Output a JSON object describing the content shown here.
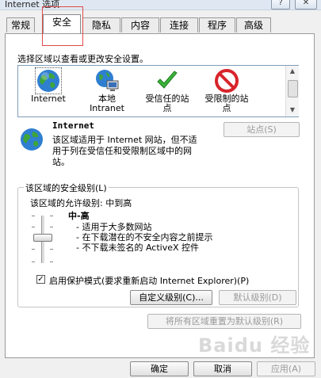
{
  "window": {
    "title": "Internet 选项",
    "help_glyph": "?",
    "close_glyph": "✕"
  },
  "tabs": [
    "常规",
    "安全",
    "隐私",
    "内容",
    "连接",
    "程序",
    "高级"
  ],
  "active_tab": "安全",
  "select_label": "选择区域以查看或更改安全设置。",
  "zones": [
    {
      "label": "Internet",
      "icon": "globe-icon"
    },
    {
      "label": "本地\nIntranet",
      "icon": "intranet-globe-icon"
    },
    {
      "label": "受信任的站\n点",
      "icon": "check-icon"
    },
    {
      "label": "受限制的站\n点",
      "icon": "restricted-icon"
    }
  ],
  "zone_info": {
    "title": "Internet",
    "description": "该区域适用于 Internet 网站，但不适用于列在受信任和受限制区域中的网站。",
    "sites_button": "站点(S)"
  },
  "security_level": {
    "group_title": "该区域的安全级别(L)",
    "allowed": "该区域的允许级别: 中到高",
    "level_name": "中-高",
    "bullets": [
      "- 适用于大多数网站",
      "- 在下载潜在的不安全内容之前提示",
      "- 不下载未签名的 ActiveX 控件"
    ],
    "protected_mode_checked": true,
    "protected_mode_label": "启用保护模式(要求重新启动 Internet Explorer)(P)",
    "custom_button": "自定义级别(C)...",
    "default_button": "默认级别(D)"
  },
  "reset_all_button": "将所有区域重置为默认级别(R)",
  "dialog_buttons": {
    "ok": "确定",
    "cancel": "取消",
    "apply": "应用(A)"
  },
  "watermark": "Baidu 经验"
}
